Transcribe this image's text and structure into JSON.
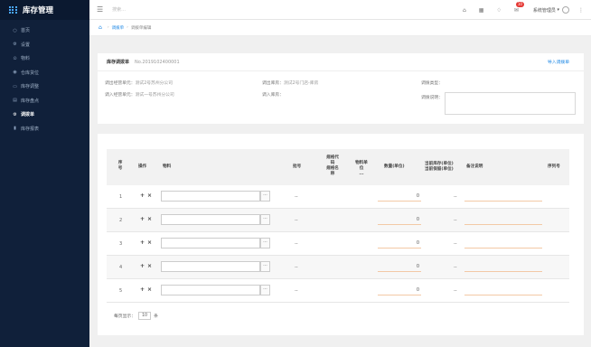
{
  "app": {
    "title": "库存管理"
  },
  "sidebar": {
    "items": [
      {
        "label": "首页",
        "icon": "home-icon",
        "glyph": "○"
      },
      {
        "label": "设置",
        "icon": "gear-icon",
        "glyph": "⚙"
      },
      {
        "label": "物料",
        "icon": "box-icon",
        "glyph": "⊙"
      },
      {
        "label": "仓库货位",
        "icon": "warehouse-icon",
        "glyph": "◉"
      },
      {
        "label": "库存调整",
        "icon": "adjust-icon",
        "glyph": "▭"
      },
      {
        "label": "库存盘点",
        "icon": "count-icon",
        "glyph": "▤"
      },
      {
        "label": "调拨单",
        "icon": "transfer-icon",
        "glyph": "⚙",
        "active": true
      },
      {
        "label": "库存报表",
        "icon": "chart-icon",
        "glyph": "▮"
      }
    ]
  },
  "topbar": {
    "search_placeholder": "搜索...",
    "badge_count": "10",
    "user_name": "系统管理员",
    "icons": [
      "home-icon",
      "grid-icon",
      "bell-icon",
      "message-icon"
    ]
  },
  "breadcrumb": {
    "link": "调拨单",
    "current": "调拨单编辑"
  },
  "form": {
    "title": "库存调拨单",
    "number": "No.2019102400001",
    "import_label": "导入调拨单",
    "out_unit_label": "调出经营单元：",
    "out_unit_value": "测试2号苏州分公司",
    "in_unit_label": "调入经营单元：",
    "in_unit_value": "测试一号苏州分公司",
    "out_wh_label": "调出库房：",
    "out_wh_value": "测试2号门店-库房",
    "in_wh_label": "调入库房：",
    "in_wh_value": "",
    "type_label": "调拨类型：",
    "type_value": "",
    "remark_label": "调拨说明："
  },
  "table": {
    "headers": {
      "seq": "序\n号",
      "op": "操作",
      "material": "物料",
      "batch": "批号",
      "spec": "规格代\n码\n规格名\n称",
      "unit": "物料单\n位\n...",
      "qty": "数量(单位)",
      "stock": "当前库存(单位)\n当前保留(单位)",
      "note": "备注说明",
      "serial": "序列号"
    },
    "rows": [
      {
        "seq": "1",
        "batch": "--",
        "qty": "0",
        "stock": "--"
      },
      {
        "seq": "2",
        "batch": "--",
        "qty": "0",
        "stock": "--"
      },
      {
        "seq": "3",
        "batch": "--",
        "qty": "0",
        "stock": "--"
      },
      {
        "seq": "4",
        "batch": "--",
        "qty": "0",
        "stock": "--"
      },
      {
        "seq": "5",
        "batch": "--",
        "qty": "0",
        "stock": "--"
      }
    ],
    "add_symbol": "+",
    "remove_symbol": "×",
    "picker_symbol": "···"
  },
  "pager": {
    "prefix": "每页显示：",
    "size": "10",
    "suffix": "条"
  }
}
